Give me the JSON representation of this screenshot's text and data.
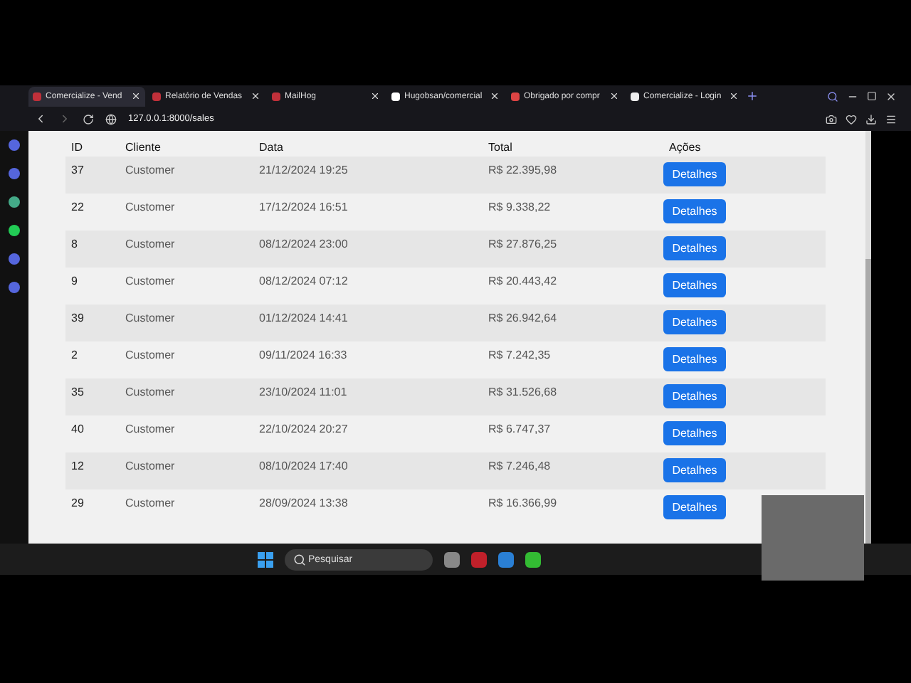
{
  "browser": {
    "tabs": [
      {
        "title": "Comercialize - Vend",
        "selected": true
      },
      {
        "title": "Relatório de Vendas",
        "selected": false
      },
      {
        "title": "MailHog",
        "selected": false
      },
      {
        "title": "Hugobsan/comercial",
        "selected": false
      },
      {
        "title": "Obrigado por compr",
        "selected": false
      },
      {
        "title": "Comercialize - Login",
        "selected": false
      }
    ],
    "address": "127.0.0.1:8000/sales"
  },
  "table": {
    "columns": [
      "ID",
      "Cliente",
      "Data",
      "Total",
      "Ações"
    ],
    "rows": [
      {
        "id": "37",
        "client": "Customer",
        "date": "21/12/2024 19:25",
        "total": "R$ 22.395,98",
        "action": "Detalhes"
      },
      {
        "id": "22",
        "client": "Customer",
        "date": "17/12/2024 16:51",
        "total": "R$ 9.338,22",
        "action": "Detalhes"
      },
      {
        "id": "8",
        "client": "Customer",
        "date": "08/12/2024 23:00",
        "total": "R$ 27.876,25",
        "action": "Detalhes"
      },
      {
        "id": "9",
        "client": "Customer",
        "date": "08/12/2024 07:12",
        "total": "R$ 20.443,42",
        "action": "Detalhes"
      },
      {
        "id": "39",
        "client": "Customer",
        "date": "01/12/2024 14:41",
        "total": "R$ 26.942,64",
        "action": "Detalhes"
      },
      {
        "id": "2",
        "client": "Customer",
        "date": "09/11/2024 16:33",
        "total": "R$ 7.242,35",
        "action": "Detalhes"
      },
      {
        "id": "35",
        "client": "Customer",
        "date": "23/10/2024 11:01",
        "total": "R$ 31.526,68",
        "action": "Detalhes"
      },
      {
        "id": "40",
        "client": "Customer",
        "date": "22/10/2024 20:27",
        "total": "R$ 6.747,37",
        "action": "Detalhes"
      },
      {
        "id": "12",
        "client": "Customer",
        "date": "08/10/2024 17:40",
        "total": "R$ 7.246,48",
        "action": "Detalhes"
      },
      {
        "id": "29",
        "client": "Customer",
        "date": "28/09/2024 13:38",
        "total": "R$ 16.366,99",
        "action": "Detalhes"
      }
    ]
  },
  "taskbar": {
    "search": {
      "placeholder": "Pesquisar"
    }
  }
}
